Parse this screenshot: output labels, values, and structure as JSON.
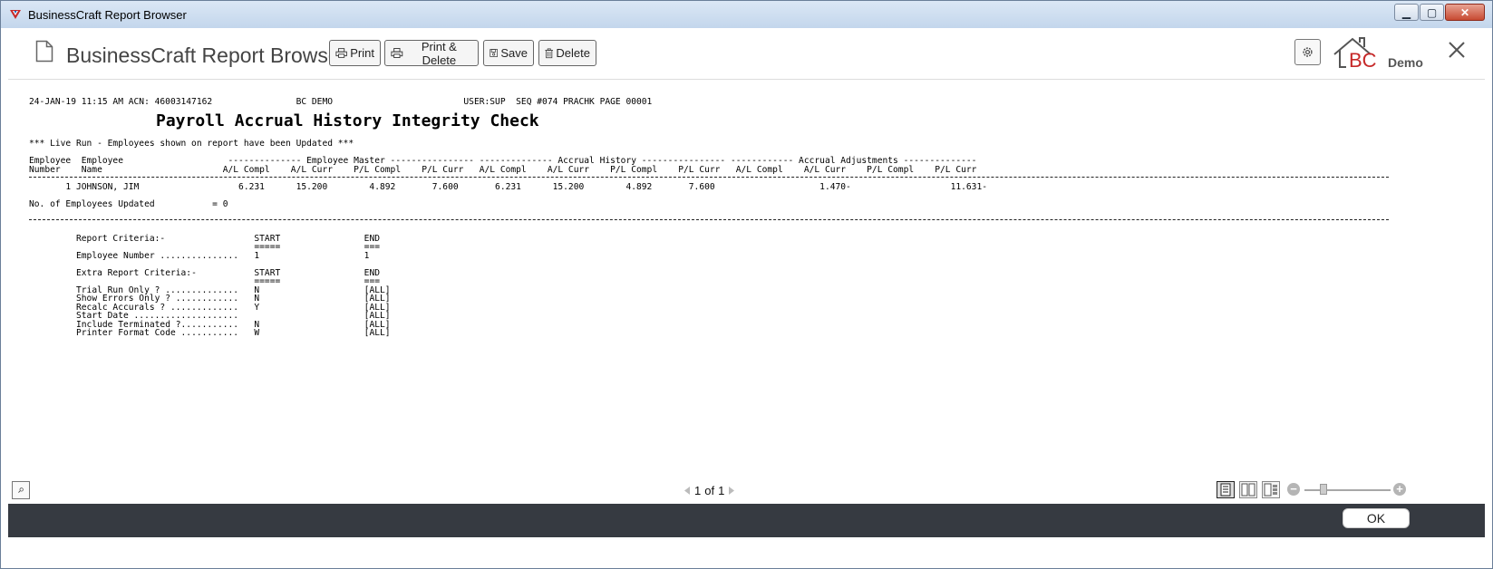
{
  "window": {
    "title": "BusinessCraft Report Browser",
    "controls": {
      "minimize": "▁",
      "maximize": "▢",
      "close": "✕"
    }
  },
  "toolbar": {
    "title": "BusinessCraft Report Browser",
    "buttons": {
      "print": "Print",
      "print_delete": "Print & Delete",
      "save": "Save",
      "delete": "Delete"
    },
    "logo_text": "BC",
    "logo_suffix": "Demo",
    "icons": [
      "document-icon",
      "printer-icon",
      "save-icon",
      "trash-icon",
      "gear-icon",
      "close-icon"
    ]
  },
  "report": {
    "header_line": "24-JAN-19 11:15 AM ACN: 46003147162                BC DEMO                         USER:SUP  SEQ #074 PRACHK PAGE 00001",
    "title": "Payroll Accrual History Integrity Check",
    "notice": "*** Live Run - Employees shown on report have been Updated ***",
    "column_header_1": "Employee  Employee                    -------------- Employee Master ---------------- -------------- Accrual History ---------------- ------------ Accrual Adjustments --------------",
    "column_header_2": "Number    Name                       A/L Compl    A/L Curr    P/L Compl    P/L Curr   A/L Compl    A/L Curr    P/L Compl    P/L Curr   A/L Compl    A/L Curr    P/L Compl    P/L Curr",
    "row": "       1 JOHNSON, JIM                   6.231      15.200        4.892       7.600       6.231      15.200        4.892       7.600                    1.470-                   11.631-",
    "summary": "No. of Employees Updated           = 0",
    "criteria": [
      "Report Criteria:-                 START                END",
      "                                  =====                ===",
      "Employee Number ...............   1                    1",
      "",
      "Extra Report Criteria:-           START                END",
      "                                  =====                ===",
      "Trial Run Only ? ..............   N                    [ALL]",
      "Show Errors Only ? ............   N                    [ALL]",
      "Recalc Accurals ? .............   Y                    [ALL]",
      "Start Date ....................                        [ALL]",
      "Include Terminated ?...........   N                    [ALL]",
      "Printer Format Code ...........   W                    [ALL]"
    ]
  },
  "pager": {
    "current": "1",
    "of_label": "of",
    "total": "1"
  },
  "footer": {
    "ok": "OK"
  }
}
